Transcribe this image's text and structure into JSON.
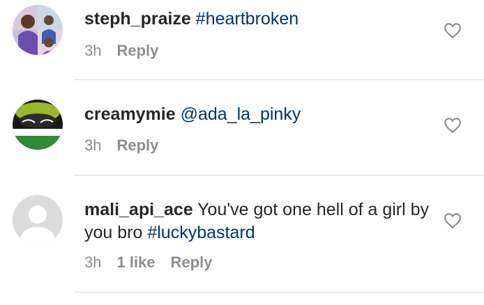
{
  "comments": [
    {
      "username": "steph_praize",
      "text": "",
      "tags": "#heartbroken",
      "time": "3h",
      "likes": "",
      "reply": "Reply"
    },
    {
      "username": "creamymie",
      "text": "",
      "tags": "@ada_la_pinky",
      "time": "3h",
      "likes": "",
      "reply": "Reply"
    },
    {
      "username": "mali_api_ace",
      "text": " You've got one hell of a girl by you bro ",
      "tags": "#luckybastard",
      "time": "3h",
      "likes": "1 like",
      "reply": "Reply"
    }
  ],
  "colors": {
    "link": "#003569",
    "muted": "#8e8e8e",
    "divider": "#dbdbdb"
  },
  "icons": {
    "like": "heart-outline-icon"
  }
}
